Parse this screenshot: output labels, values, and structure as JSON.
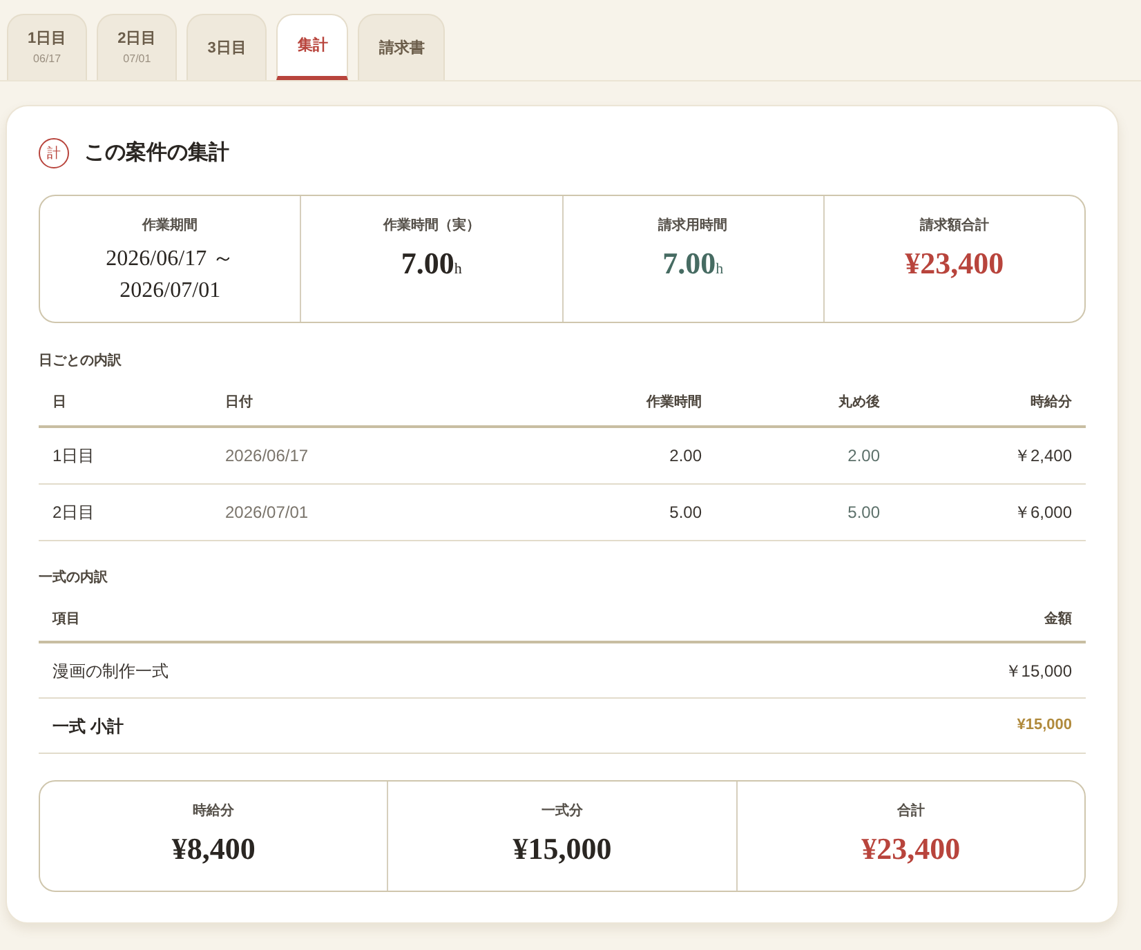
{
  "tabs": [
    {
      "label": "1日目",
      "sub": "06/17",
      "selected": false
    },
    {
      "label": "2日目",
      "sub": "07/01",
      "selected": false
    },
    {
      "label": "3日目",
      "selected": false
    },
    {
      "label": "集計",
      "selected": true
    },
    {
      "label": "請求書",
      "selected": false
    }
  ],
  "summary": {
    "icon_text": "計",
    "title": "この案件の集計",
    "stats": [
      {
        "kind": "period",
        "label": "作業期間",
        "lines": [
          "2026/06/17 ～",
          "2026/07/01"
        ],
        "color": "#2a2622"
      },
      {
        "kind": "hours",
        "label": "作業時間（実）",
        "value": "7.00",
        "unit": "h",
        "color": "#2a2622"
      },
      {
        "kind": "hours",
        "label": "請求用時間",
        "value": "7.00",
        "unit": "h",
        "color": "#466b62"
      },
      {
        "kind": "amount",
        "label": "請求額合計",
        "value": "¥23,400",
        "color": "#b8443c"
      }
    ]
  },
  "daily": {
    "heading": "日ごとの内訳",
    "columns": [
      "日",
      "日付",
      "作業時間",
      "丸め後",
      "時給分"
    ],
    "rows": [
      [
        "1日目",
        "2026/06/17",
        "2.00",
        "2.00",
        "￥2,400"
      ],
      [
        "2日目",
        "2026/07/01",
        "5.00",
        "5.00",
        "￥6,000"
      ]
    ]
  },
  "lump": {
    "heading": "一式の内訳",
    "columns": [
      "項目",
      "金額"
    ],
    "rows": [
      [
        "漫画の制作一式",
        "￥15,000"
      ]
    ],
    "subtotal": {
      "label": "一式 小計",
      "amount": "¥15,000"
    }
  },
  "totals": [
    {
      "label": "時給分",
      "value": "¥8,400",
      "color": "#2a2622"
    },
    {
      "label": "一式分",
      "value": "¥15,000",
      "color": "#2a2622"
    },
    {
      "label": "合計",
      "value": "¥23,400",
      "color": "#b8443c"
    }
  ]
}
